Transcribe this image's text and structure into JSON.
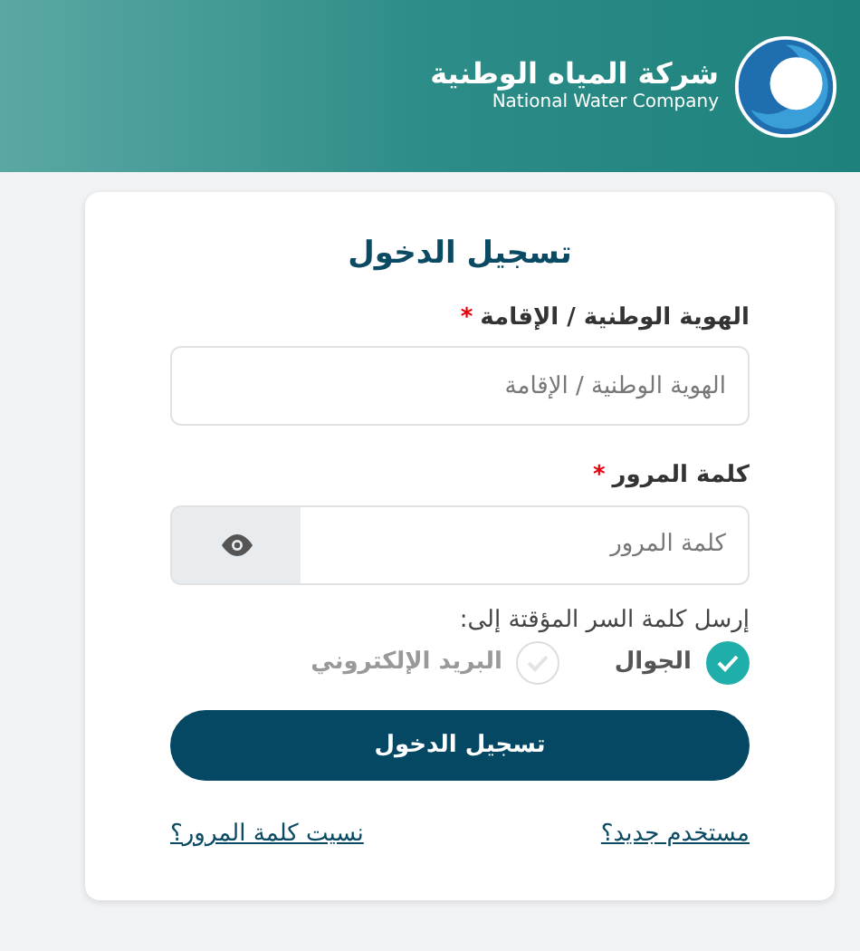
{
  "header": {
    "logo_arabic": "شركة المياه الوطنية",
    "logo_english": "National Water Company"
  },
  "form": {
    "title": "تسجيل الدخول",
    "fields": [
      {
        "label": "الهوية الوطنية / الإقامة",
        "required_mark": "*",
        "placeholder": "الهوية الوطنية / الإقامة",
        "kind": "text"
      },
      {
        "label": "كلمة المرور",
        "required_mark": "*",
        "placeholder": "كلمة المرور",
        "kind": "password"
      }
    ],
    "otp_prompt": "إرسل كلمة السر المؤقتة إلى:",
    "otp_options": [
      {
        "label": "الجوال",
        "selected": true
      },
      {
        "label": "البريد الإلكتروني",
        "selected": false
      }
    ],
    "submit": "تسجيل الدخول",
    "links": [
      "مستخدم جديد؟",
      "نسيت كلمة المرور؟"
    ]
  }
}
